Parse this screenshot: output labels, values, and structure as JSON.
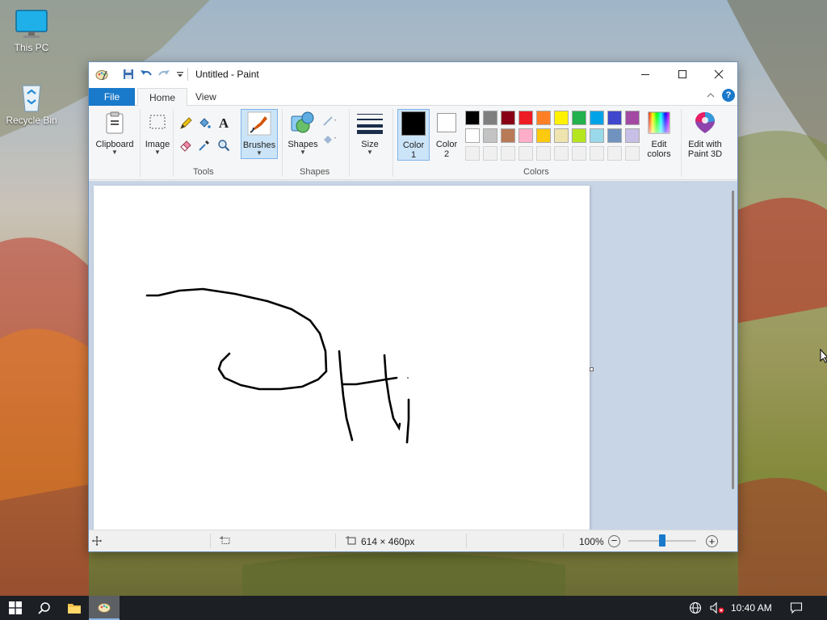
{
  "desktop": {
    "icons": [
      {
        "label": "This PC"
      },
      {
        "label": "Recycle Bin"
      }
    ]
  },
  "window": {
    "title": "Untitled - Paint",
    "tabs": {
      "file": "File",
      "home": "Home",
      "view": "View"
    }
  },
  "ribbon": {
    "clipboard": {
      "label": "Clipboard"
    },
    "image": {
      "label": "Image"
    },
    "tools": {
      "group_label": "Tools"
    },
    "brushes": {
      "label": "Brushes"
    },
    "shapes": {
      "label": "Shapes",
      "group_label": "Shapes"
    },
    "size": {
      "label": "Size"
    },
    "color1": {
      "line1": "Color",
      "line2": "1",
      "value": "#000000"
    },
    "color2": {
      "line1": "Color",
      "line2": "2",
      "value": "#ffffff"
    },
    "colors_group_label": "Colors",
    "edit_colors": {
      "line1": "Edit",
      "line2": "colors"
    },
    "paint3d": {
      "line1": "Edit with",
      "line2": "Paint 3D"
    },
    "palette_row1": [
      "#000000",
      "#7f7f7f",
      "#880015",
      "#ed1c24",
      "#ff7f27",
      "#fff200",
      "#22b14c",
      "#00a2e8",
      "#3f48cc",
      "#a349a4"
    ],
    "palette_row2": [
      "#ffffff",
      "#c3c3c3",
      "#b97a57",
      "#ffaec9",
      "#ffc90e",
      "#efe4b0",
      "#b5e61d",
      "#99d9ea",
      "#7092be",
      "#c8bfe7"
    ]
  },
  "statusbar": {
    "dimensions": "614 × 460px",
    "zoom": "100%"
  },
  "taskbar": {
    "time": "10:40 AM"
  },
  "colors": {
    "accent": "#1979ca",
    "canvas_bg": "#ffffff",
    "workarea_bg": "#c8d5e6"
  }
}
